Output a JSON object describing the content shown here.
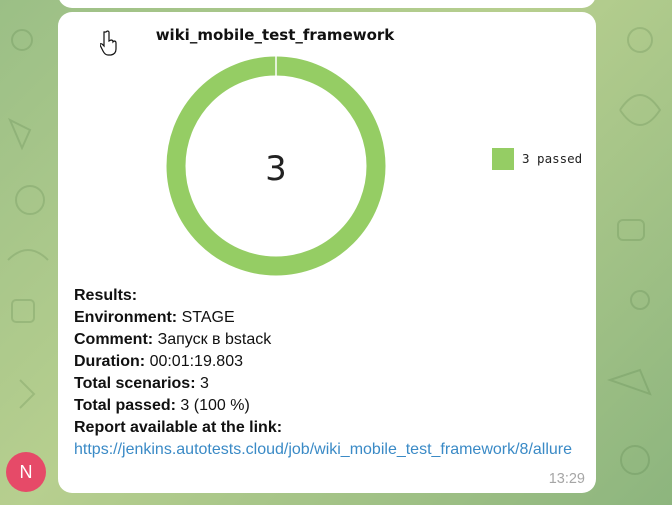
{
  "avatar": {
    "initial": "N",
    "color": "#e64a68"
  },
  "report": {
    "chart_data": {
      "type": "pie",
      "title": "wiki_mobile_test_framework",
      "center_label": "3",
      "slices": [
        {
          "name": "3 passed",
          "value": 3,
          "color": "#95cd64"
        }
      ],
      "legend_placement": "right"
    },
    "results_heading": "Results:",
    "lines": [
      {
        "label": "Environment:",
        "value": "STAGE"
      },
      {
        "label": "Comment:",
        "value": "Запуск в bstack"
      },
      {
        "label": "Duration:",
        "value": "00:01:19.803"
      },
      {
        "label": "Total scenarios:",
        "value": "3"
      },
      {
        "label": "Total passed:",
        "value": "3 (100 %)"
      }
    ],
    "link_label": "Report available at the link:",
    "link": "https://jenkins.autotests.cloud/job/wiki_mobile_test_framework/8/allure",
    "time": "13:29"
  }
}
